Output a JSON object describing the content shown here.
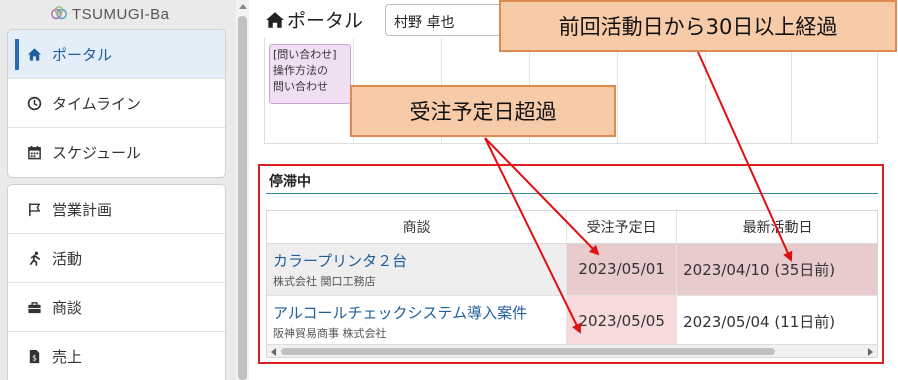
{
  "sidebar": {
    "logo_text": "TSUMUGI-Ba",
    "group1": [
      {
        "label": "ポータル",
        "icon": "home-icon",
        "active": true
      },
      {
        "label": "タイムライン",
        "icon": "clock-icon"
      },
      {
        "label": "スケジュール",
        "icon": "calendar-icon"
      }
    ],
    "group2": [
      {
        "label": "営業計画",
        "icon": "flag-icon"
      },
      {
        "label": "活動",
        "icon": "running-icon"
      },
      {
        "label": "商談",
        "icon": "briefcase-icon"
      },
      {
        "label": "売上",
        "icon": "invoice-icon"
      }
    ]
  },
  "header": {
    "title": "ポータル",
    "user_select_value": "村野 卓也"
  },
  "calendar": {
    "event_lines": [
      "[問い合わせ]",
      "操作方法の",
      "問い合わせ"
    ]
  },
  "stalled": {
    "title": "停滞中",
    "columns": [
      "商談",
      "受注予定日",
      "最新活動日"
    ],
    "rows": [
      {
        "deal": "カラープリンタ２台",
        "company": "株式会社 関口工務店",
        "order_date": "2023/05/01",
        "last_activity": "2023/04/10 (35日前)"
      },
      {
        "deal": "アルコールチェックシステム導入案件",
        "company": "阪神貿易商事 株式会社",
        "order_date": "2023/05/05",
        "last_activity": "2023/05/04 (11日前)"
      }
    ]
  },
  "callouts": {
    "order_overdue": "受注予定日超過",
    "activity_overdue": "前回活動日から30日以上経過"
  },
  "colors": {
    "annotation_border": "#e02020",
    "callout_fill": "#f8cba8",
    "link": "#1f5e9c",
    "active_nav": "#2b6cb0"
  }
}
